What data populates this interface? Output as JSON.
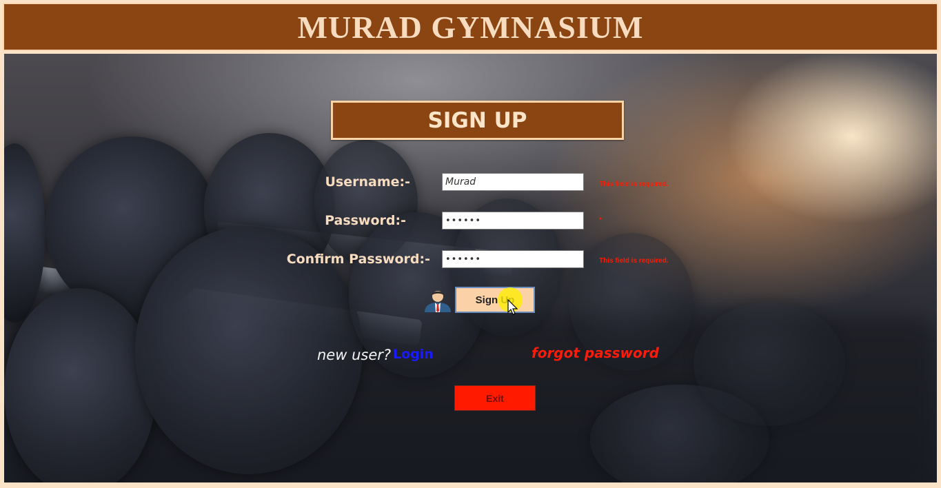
{
  "header": {
    "title": "MURAD GYMNASIUM"
  },
  "form": {
    "title": "SIGN UP",
    "username": {
      "label": "Username:-",
      "value": "Murad",
      "error": "This field is required."
    },
    "password": {
      "label": "Password:-",
      "value": "••••••",
      "error": "*"
    },
    "confirm_password": {
      "label": "Confirm Password:-",
      "value": "••••••",
      "error": "This field is required."
    },
    "signup_button": "Sign Up",
    "new_user_text": "new user?",
    "login_link": "Login",
    "forgot_link": "forgot password",
    "exit_button": "Exit"
  },
  "colors": {
    "header_bg": "#8b4513",
    "header_text": "#f8dcbf",
    "label_text": "#f7dcc0",
    "error": "#ff1a00",
    "login_link": "#1a1aff",
    "exit_bg": "#ff1a00",
    "signup_bg": "#fbd2a8"
  },
  "icons": {
    "user_avatar": "businessman-avatar-icon",
    "cursor": "mouse-pointer-icon"
  }
}
